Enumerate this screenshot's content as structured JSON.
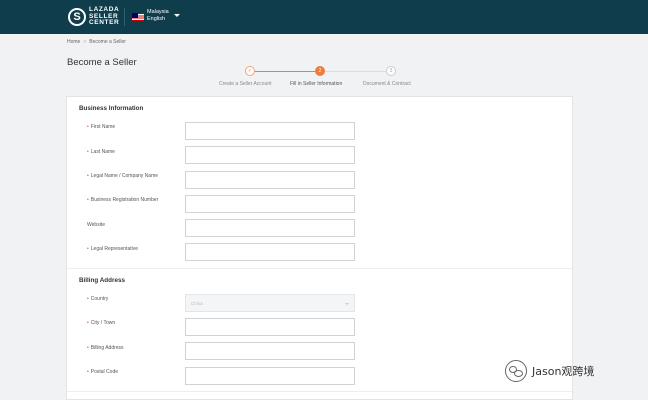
{
  "header": {
    "logo_mark": "S",
    "brand_line1": "LAZADA",
    "brand_line2": "SELLER",
    "brand_line3": "CENTER",
    "country": "Malaysia",
    "language": "English"
  },
  "breadcrumb": {
    "home": "Home",
    "separator": ">",
    "current": "Become a Seller"
  },
  "page_title": "Become a Seller",
  "steps": [
    {
      "number": "✓",
      "label": "Create a Seller Account",
      "state": "done"
    },
    {
      "number": "2",
      "label": "Fill in Seller Information",
      "state": "current"
    },
    {
      "number": "3",
      "label": "Document & Contract",
      "state": "pending"
    }
  ],
  "colors": {
    "header_bg": "#0f3d4c",
    "accent": "#f07a3b",
    "required": "#e94b4b"
  },
  "business": {
    "title": "Business Information",
    "fields": [
      {
        "label": "First Name",
        "required": true,
        "value": ""
      },
      {
        "label": "Last Name",
        "required": true,
        "value": ""
      },
      {
        "label": "Legal Name / Company Name",
        "required": true,
        "value": ""
      },
      {
        "label": "Business Registration Number",
        "required": true,
        "value": ""
      },
      {
        "label": "Website",
        "required": false,
        "value": ""
      },
      {
        "label": "Legal Representative",
        "required": true,
        "value": ""
      }
    ]
  },
  "billing": {
    "title": "Billing Address",
    "fields": [
      {
        "label": "Country",
        "required": true,
        "value": "China",
        "type": "select"
      },
      {
        "label": "City / Town",
        "required": true,
        "value": ""
      },
      {
        "label": "Billing Address",
        "required": true,
        "value": ""
      },
      {
        "label": "Postal Code",
        "required": true,
        "value": ""
      }
    ]
  },
  "watermark": {
    "text": "Jason观跨境",
    "icon": "wechat-icon"
  }
}
